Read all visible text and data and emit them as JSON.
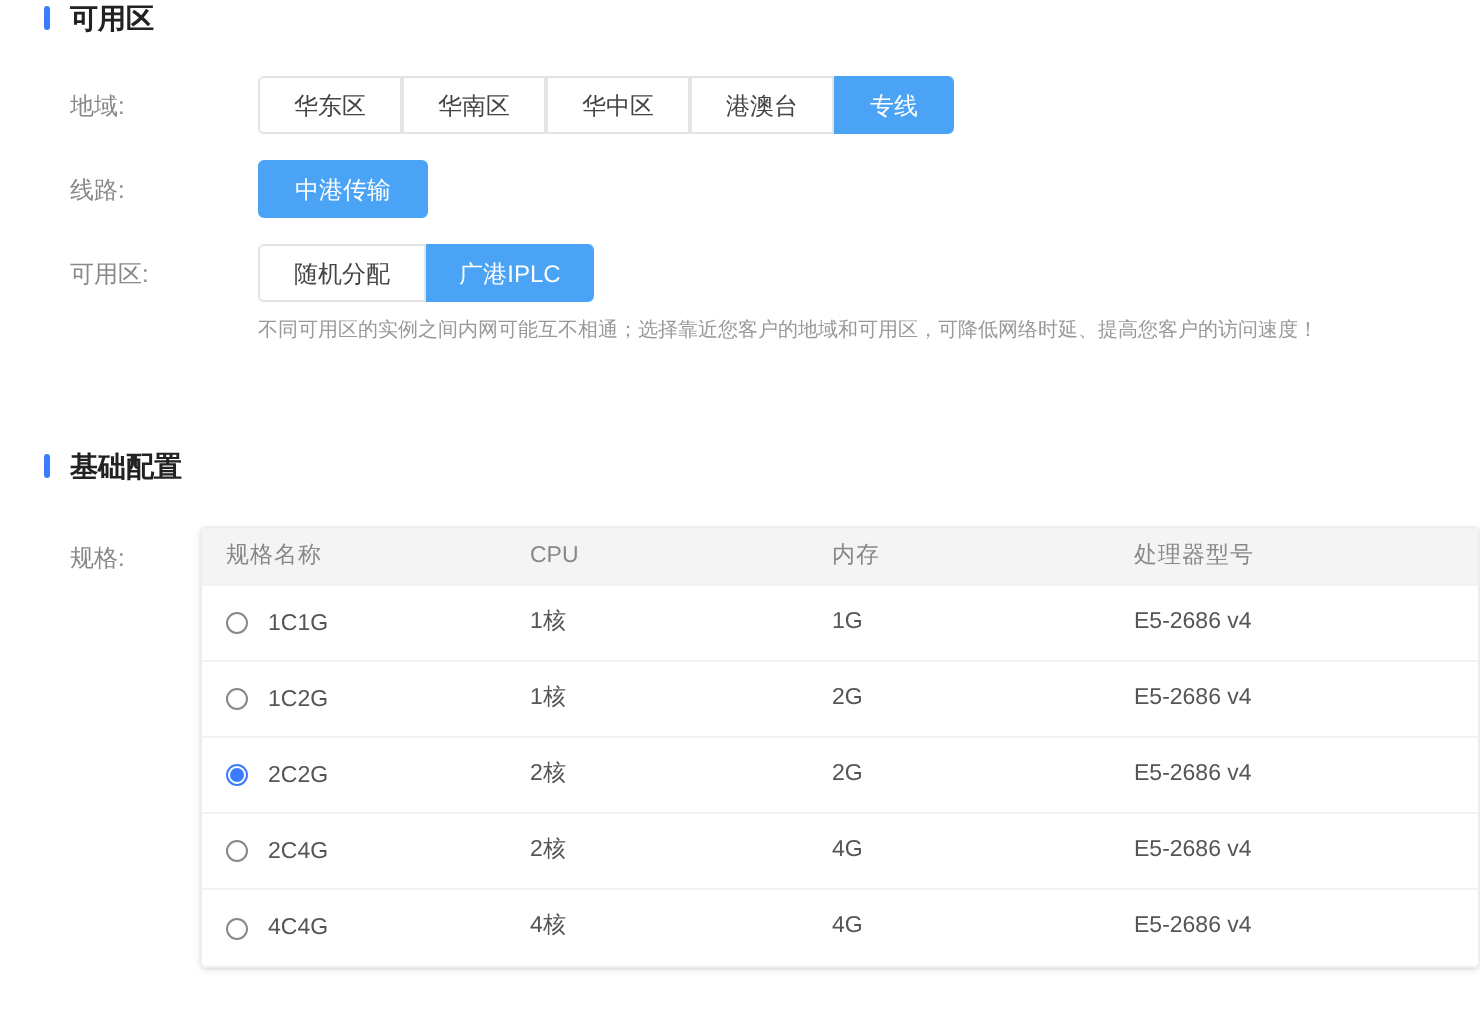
{
  "availability_section": {
    "title": "可用区",
    "region": {
      "label": "地域:",
      "options": [
        {
          "label": "华东区",
          "selected": false
        },
        {
          "label": "华南区",
          "selected": false
        },
        {
          "label": "华中区",
          "selected": false
        },
        {
          "label": "港澳台",
          "selected": false
        },
        {
          "label": "专线",
          "selected": true
        }
      ]
    },
    "line": {
      "label": "线路:",
      "options": [
        {
          "label": "中港传输",
          "selected": true
        }
      ]
    },
    "zone": {
      "label": "可用区:",
      "options": [
        {
          "label": "随机分配",
          "selected": false
        },
        {
          "label": "广港IPLC",
          "selected": true
        }
      ]
    },
    "hint": "不同可用区的实例之间内网可能互不相通；选择靠近您客户的地域和可用区，可降低网络时延、提高您客户的访问速度！"
  },
  "basic_config_section": {
    "title": "基础配置",
    "spec_label": "规格:",
    "table": {
      "columns": [
        "规格名称",
        "CPU",
        "内存",
        "处理器型号"
      ],
      "rows": [
        {
          "selected": false,
          "cells": [
            "1C1G",
            "1核",
            "1G",
            "E5-2686 v4"
          ]
        },
        {
          "selected": false,
          "cells": [
            "1C2G",
            "1核",
            "2G",
            "E5-2686 v4"
          ]
        },
        {
          "selected": true,
          "cells": [
            "2C2G",
            "2核",
            "2G",
            "E5-2686 v4"
          ]
        },
        {
          "selected": false,
          "cells": [
            "2C4G",
            "2核",
            "4G",
            "E5-2686 v4"
          ]
        },
        {
          "selected": false,
          "cells": [
            "4C4G",
            "4核",
            "4G",
            "E5-2686 v4"
          ]
        }
      ]
    }
  }
}
